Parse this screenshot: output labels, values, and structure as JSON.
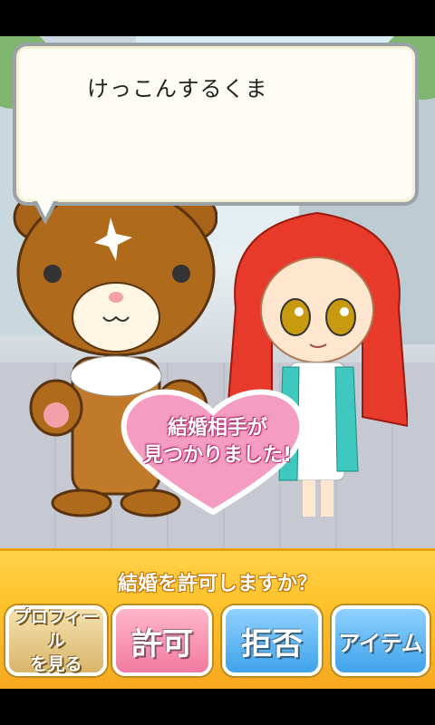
{
  "dialogue": {
    "text": "けっこんするくま"
  },
  "result": {
    "line1": "結婚相手が",
    "line2": "見つかりました!"
  },
  "prompt": {
    "question": "結婚を許可しますか？"
  },
  "buttons": {
    "profile_line1": "プロフィール",
    "profile_line2": "を見る",
    "permit": "許可",
    "reject": "拒否",
    "item": "アイテム"
  },
  "colors": {
    "panel": "#ffc22a",
    "permit": "#f27aa0",
    "reject": "#3fa2ea",
    "heart": "#f59cc2"
  }
}
